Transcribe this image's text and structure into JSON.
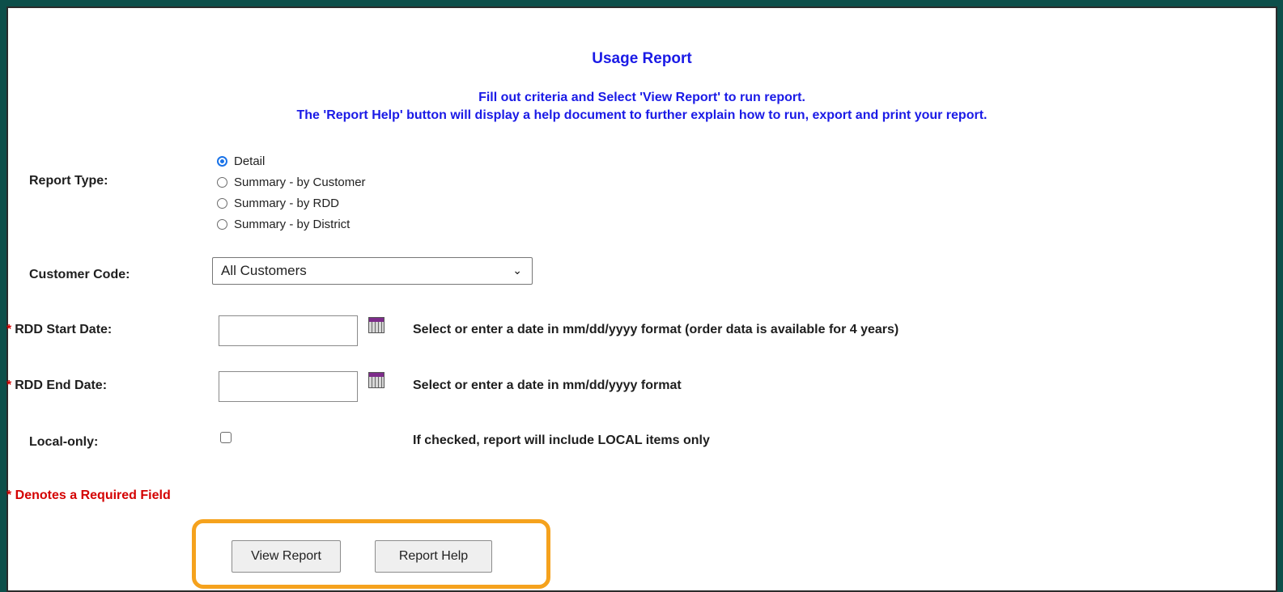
{
  "page": {
    "title": "Usage Report",
    "subtitle_line1": "Fill out criteria and Select 'View Report' to run report.",
    "subtitle_line2": "The 'Report Help' button will display a help document to further explain how to run, export and print your report."
  },
  "report_type": {
    "label": "Report Type:",
    "options": [
      "Detail",
      "Summary - by Customer",
      "Summary - by RDD",
      "Summary - by District"
    ],
    "selected": "Detail"
  },
  "customer_code": {
    "label": "Customer Code:",
    "value": "All Customers"
  },
  "rdd_start": {
    "required_mark": "*",
    "label": "RDD Start Date:",
    "value": "",
    "hint": "Select or enter a date in mm/dd/yyyy format (order data is available for 4 years)"
  },
  "rdd_end": {
    "required_mark": "*",
    "label": "RDD End Date:",
    "value": "",
    "hint": "Select or enter a date in mm/dd/yyyy format"
  },
  "local_only": {
    "label": "Local-only:",
    "checked": false,
    "hint": "If checked, report will include LOCAL items only"
  },
  "required_note": "* Denotes a Required Field",
  "buttons": {
    "view_report": "View Report",
    "report_help": "Report Help"
  },
  "colors": {
    "header_blue": "#1a1ae6",
    "required_red": "#d40000",
    "highlight_orange": "#f5a21d",
    "page_border_teal": "#0d4f4a"
  }
}
